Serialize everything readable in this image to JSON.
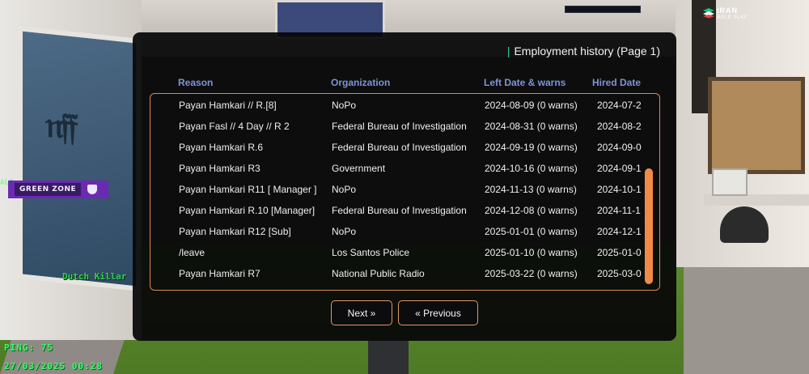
{
  "dialog": {
    "title": "Employment history (Page 1)",
    "columns": {
      "reason": "Reason",
      "organization": "Organization",
      "left_date": "Left Date & warns",
      "hired_date": "Hired Date"
    },
    "rows": [
      {
        "reason": "Payan Hamkari // R.[8]",
        "organization": "NoPo",
        "left": "2024-08-09 (0 warns)",
        "hired": "2024-07-2"
      },
      {
        "reason": "Payan Fasl // 4 Day // R 2",
        "organization": "Federal Bureau of Investigation",
        "left": "2024-08-31 (0 warns)",
        "hired": "2024-08-2"
      },
      {
        "reason": "Payan Hamkari R.6",
        "organization": "Federal Bureau of Investigation",
        "left": "2024-09-19 (0 warns)",
        "hired": "2024-09-0"
      },
      {
        "reason": "Payan Hamkari R3",
        "organization": "Government",
        "left": "2024-10-16 (0 warns)",
        "hired": "2024-09-1"
      },
      {
        "reason": "Payan Hamkari R11 [ Manager ]",
        "organization": "NoPo",
        "left": "2024-11-13 (0 warns)",
        "hired": "2024-10-1"
      },
      {
        "reason": "Payan Hamkari R.10 [Manager]",
        "organization": "Federal Bureau of Investigation",
        "left": "2024-12-08 (0 warns)",
        "hired": "2024-11-1"
      },
      {
        "reason": "Payan Hamkari R12 [Sub]",
        "organization": "NoPo",
        "left": "2025-01-01 (0 warns)",
        "hired": "2024-12-1"
      },
      {
        "reason": "/leave",
        "organization": "Los Santos Police",
        "left": "2025-01-10 (0 warns)",
        "hired": "2025-01-0"
      },
      {
        "reason": "Payan Hamkari R7",
        "organization": "National Public Radio",
        "left": "2025-03-22 (0 warns)",
        "hired": "2025-03-0"
      }
    ],
    "next_label": "Next »",
    "prev_label": "« Previous"
  },
  "hud": {
    "zone_alt": "ALT",
    "zone_label": "GREEN ZONE",
    "player_name": "Dutch Killar",
    "ping": "PING: 75",
    "datetime": "27/03/2025 00:28",
    "logo_line1": "IRAN",
    "logo_line2": "ROLE PLAY"
  },
  "colors": {
    "accent": "#f18a47",
    "header_text": "#7c95d6",
    "title_bar": "#34d399",
    "zone": "#6a2ab3",
    "hud_green": "#38ff62"
  }
}
